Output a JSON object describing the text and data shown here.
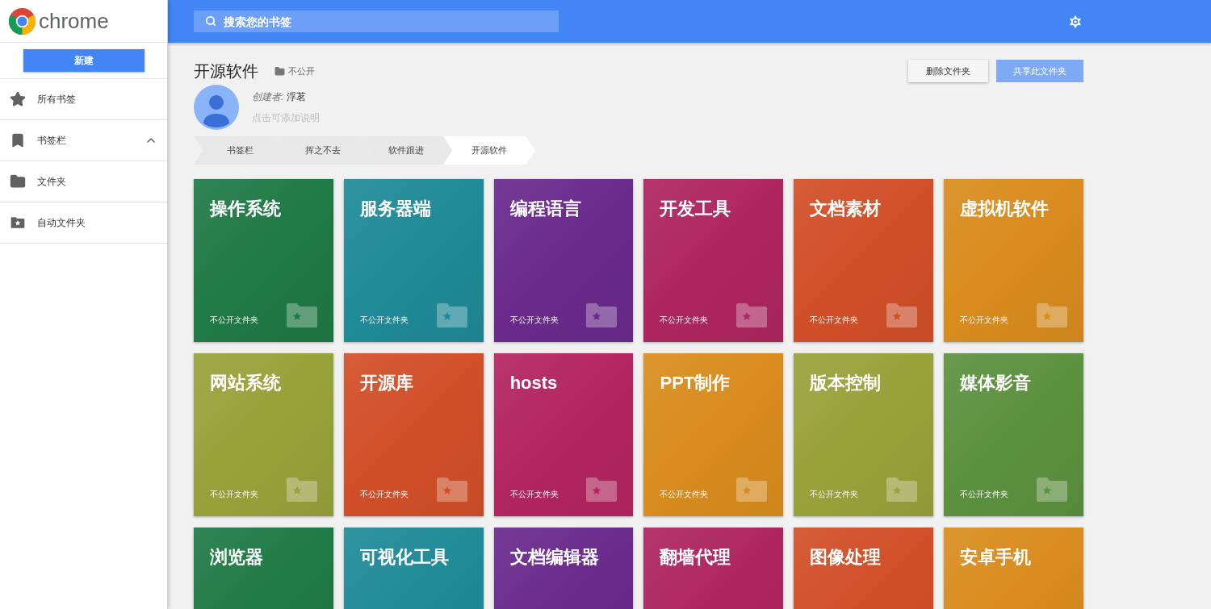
{
  "logo": {
    "text": "chrome"
  },
  "sidebar": {
    "new_button": "新建",
    "items": [
      {
        "kind": "star",
        "label": "所有书签"
      },
      {
        "kind": "bookmark",
        "label": "书签栏",
        "expanded": true
      },
      {
        "kind": "folder",
        "label": "文件夹"
      },
      {
        "kind": "star-folder",
        "label": "自动文件夹"
      }
    ]
  },
  "search": {
    "placeholder": "搜索您的书签"
  },
  "folder": {
    "title": "开源软件",
    "privacy": "不公开",
    "creator_label": "创建者:",
    "creator": "浮茗",
    "description_placeholder": "点击可添加说明"
  },
  "actions": [
    {
      "kind": "plain",
      "label": "删除文件夹"
    },
    {
      "kind": "primary",
      "label": "共享此文件夹"
    }
  ],
  "breadcrumbs": [
    {
      "label": "书签栏",
      "selected": false
    },
    {
      "label": "挥之不去",
      "selected": false
    },
    {
      "label": "软件跟进",
      "selected": false
    },
    {
      "label": "开源软件",
      "selected": true
    }
  ],
  "tiles": [
    {
      "title": "操作系统",
      "label": "不公开文件夹",
      "color": "#1f7a45"
    },
    {
      "title": "服务器端",
      "label": "不公开文件夹",
      "color": "#1f8a98"
    },
    {
      "title": "编程语言",
      "label": "不公开文件夹",
      "color": "#6a2a8c"
    },
    {
      "title": "开发工具",
      "label": "不公开文件夹",
      "color": "#ae2560"
    },
    {
      "title": "文档素材",
      "label": "不公开文件夹",
      "color": "#d14f28"
    },
    {
      "title": "虚拟机软件",
      "label": "不公开文件夹",
      "color": "#d98c1e"
    },
    {
      "title": "网站系统",
      "label": "不公开文件夹",
      "color": "#98a23a"
    },
    {
      "title": "开源库",
      "label": "不公开文件夹",
      "color": "#d14f28"
    },
    {
      "title": "hosts",
      "label": "不公开文件夹",
      "color": "#b3255f"
    },
    {
      "title": "PPT制作",
      "label": "不公开文件夹",
      "color": "#d98c1e"
    },
    {
      "title": "版本控制",
      "label": "不公开文件夹",
      "color": "#98a23a"
    },
    {
      "title": "媒体影音",
      "label": "不公开文件夹",
      "color": "#5c913f"
    },
    {
      "title": "浏览器",
      "color": "#1f7a45"
    },
    {
      "title": "可视化工具",
      "color": "#1f8a98"
    },
    {
      "title": "文档编辑器",
      "color": "#6a2a8c"
    },
    {
      "title": "翻墙代理",
      "color": "#ae2560"
    },
    {
      "title": "图像处理",
      "color": "#d14f28"
    },
    {
      "title": "安卓手机",
      "color": "#d98c1e"
    }
  ]
}
